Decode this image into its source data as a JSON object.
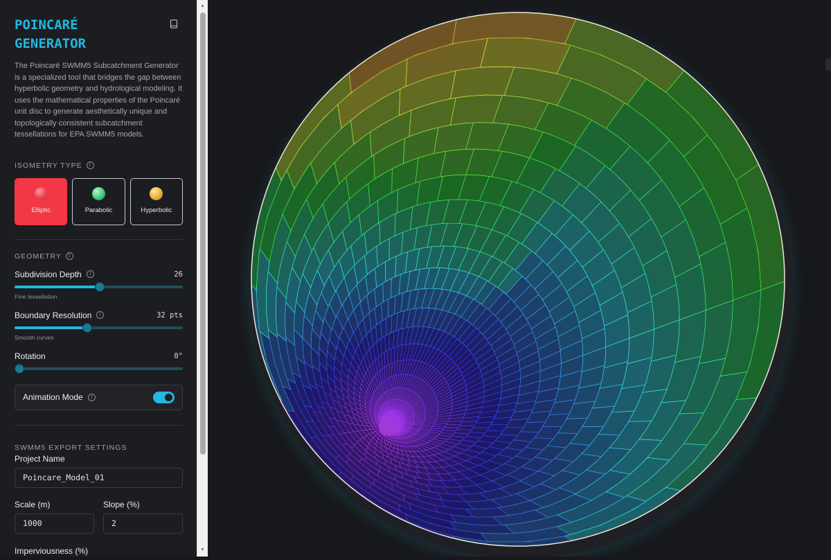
{
  "header": {
    "title_line1": "POINCARÉ",
    "title_line2": "GENERATOR",
    "description": "The Poincaré SWMM5 Subcatchment Generator is a specialized tool that bridges the gap between hyperbolic geometry and hydrological modeling. It uses the mathematical properties of the Poincaré unit disc to generate aesthetically unique and topologically consistent subcatchment tessellations for EPA SWMM5 models."
  },
  "isometry": {
    "label": "ISOMETRY TYPE",
    "options": [
      {
        "label": "Elliptic",
        "active": true,
        "sphere_color": "#ff5a68"
      },
      {
        "label": "Parabolic",
        "active": false,
        "sphere_color": "#4ed58a"
      },
      {
        "label": "Hyperbolic",
        "active": false,
        "sphere_color": "#f2b94a"
      }
    ]
  },
  "geometry": {
    "label": "GEOMETRY",
    "subdivision": {
      "label": "Subdivision Depth",
      "value": "26",
      "hint": "Fine tessellation",
      "level": 0.5
    },
    "boundary": {
      "label": "Boundary Resolution",
      "value": "32 pts",
      "hint": "Smooth curves",
      "level": 0.43
    },
    "rotation": {
      "label": "Rotation",
      "value": "0°",
      "level": 0
    },
    "animation": {
      "label": "Animation Mode",
      "on": true
    }
  },
  "export": {
    "label": "SWMM5 EXPORT SETTINGS",
    "project_name_label": "Project Name",
    "project_name": "Poincare_Model_01",
    "scale_label": "Scale (m)",
    "scale": "1000",
    "slope_label": "Slope (%)",
    "slope": "2",
    "imperviousness_label": "Imperviousness (%)"
  },
  "colors": {
    "accent": "#22b8e0",
    "active_button": "#f23845",
    "background": "#17181c"
  }
}
